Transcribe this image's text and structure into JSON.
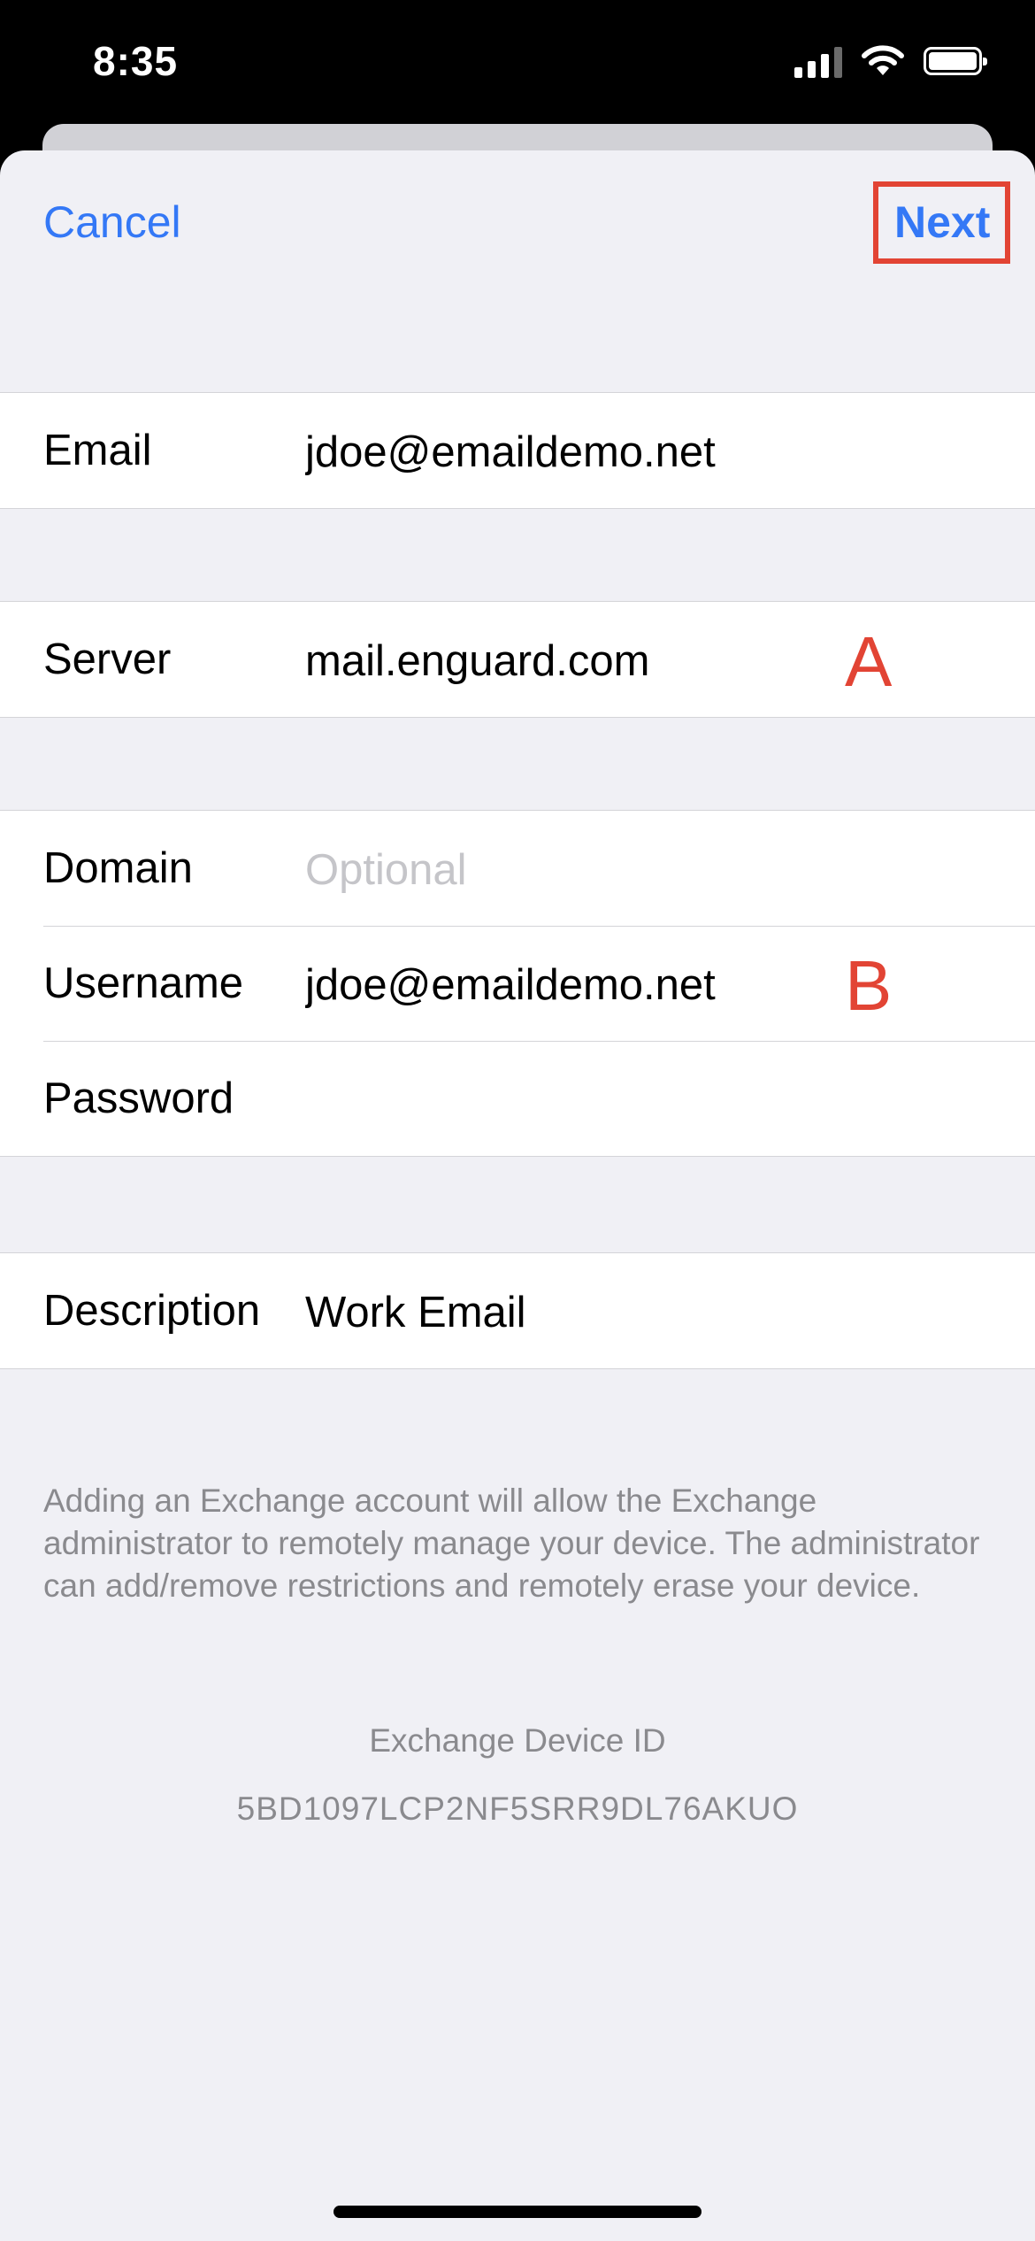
{
  "status_bar": {
    "time": "8:35",
    "icons": [
      "cellular-signal-icon",
      "wifi-icon",
      "battery-icon"
    ]
  },
  "nav": {
    "cancel_label": "Cancel",
    "next_label": "Next"
  },
  "form": {
    "email": {
      "label": "Email",
      "value": "jdoe@emaildemo.net"
    },
    "server": {
      "label": "Server",
      "value": "mail.enguard.com",
      "marker": "A"
    },
    "domain": {
      "label": "Domain",
      "value": "",
      "placeholder": "Optional"
    },
    "username": {
      "label": "Username",
      "value": "jdoe@emaildemo.net",
      "marker": "B"
    },
    "password": {
      "label": "Password",
      "value": ""
    },
    "description": {
      "label": "Description",
      "value": "Work Email"
    }
  },
  "footer": {
    "notice": "Adding an Exchange account will allow the Exchange administrator to remotely manage your device. The administrator can add/remove restrictions and remotely erase your device.",
    "device_id_label": "Exchange Device ID",
    "device_id": "5BD1097LCP2NF5SRR9DL76AKUO"
  },
  "colors": {
    "accent": "#3478f6",
    "annotation": "#e24434",
    "background": "#f0f0f5",
    "secondary_text": "#8a8a8e"
  }
}
